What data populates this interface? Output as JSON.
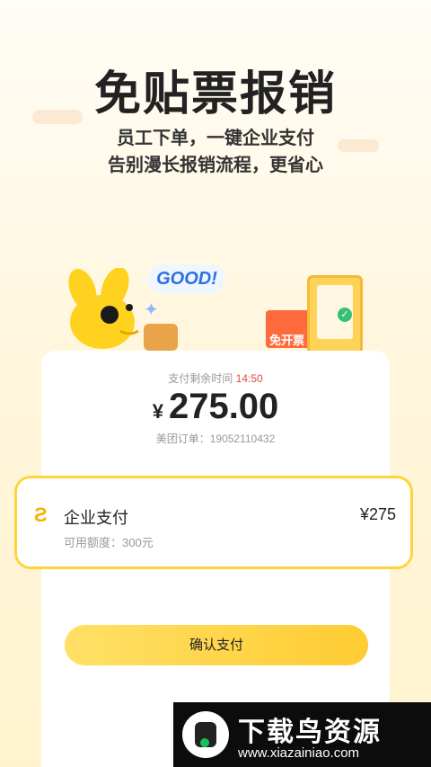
{
  "hero": {
    "title": "免贴票报销",
    "line1": "员工下单，一键企业支付",
    "line2": "告别漫长报销流程，更省心"
  },
  "illustration": {
    "good_text": "GOOD!",
    "gift_label": "免开票",
    "icons": [
      "mascot-rabbit-icon",
      "wallet-icon",
      "gift-box-icon",
      "qr-phone-icon",
      "check-icon",
      "sparkle-icon"
    ]
  },
  "payment": {
    "timer_label": "支付剩余时间",
    "timer_value": "14:50",
    "currency": "¥",
    "amount": "275.00",
    "order_label": "美团订单：",
    "order_no": "19052110432"
  },
  "option": {
    "name": "企业支付",
    "price": "¥275",
    "credit_label": "可用额度：",
    "credit_value": "300元"
  },
  "confirm_label": "确认支付",
  "watermark": {
    "title": "下载鸟资源",
    "url": "www.xiazainiao.com"
  },
  "colors": {
    "accent": "#ffd43b",
    "alert": "#e24a3b",
    "watermark_bg": "#0c0c0c"
  }
}
